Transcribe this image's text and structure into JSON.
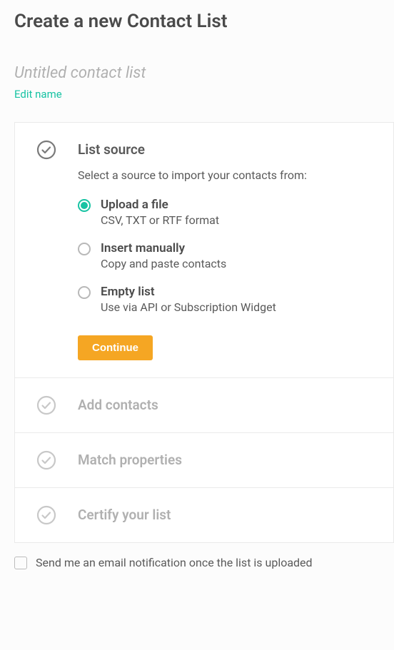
{
  "page": {
    "title": "Create a new Contact List",
    "list_name": "Untitled contact list",
    "edit_name_label": "Edit name"
  },
  "steps": {
    "source": {
      "title": "List source",
      "desc": "Select a source to import your contacts from:",
      "options": [
        {
          "title": "Upload a file",
          "sub": "CSV, TXT or RTF format",
          "selected": true
        },
        {
          "title": "Insert manually",
          "sub": "Copy and paste contacts",
          "selected": false
        },
        {
          "title": "Empty list",
          "sub": "Use via API or Subscription Widget",
          "selected": false
        }
      ],
      "continue_label": "Continue"
    },
    "add_contacts": {
      "title": "Add contacts"
    },
    "match_properties": {
      "title": "Match properties"
    },
    "certify": {
      "title": "Certify your list"
    }
  },
  "notify": {
    "label": "Send me an email notification once the list is uploaded"
  }
}
